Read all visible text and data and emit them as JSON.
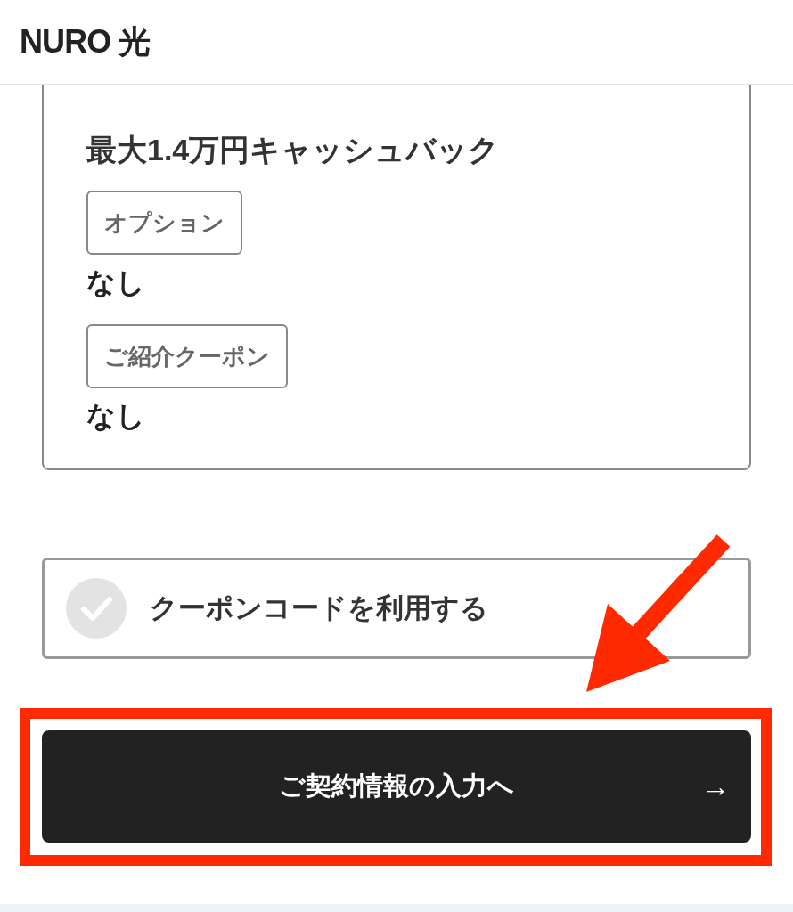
{
  "header": {
    "logo": "NURO 光"
  },
  "plan_card": {
    "title": "最大1.4万円キャッシュバック",
    "fields": [
      {
        "label": "オプション",
        "value": "なし"
      },
      {
        "label": "ご紹介クーポン",
        "value": "なし"
      }
    ]
  },
  "coupon_option": {
    "label": "クーポンコードを利用する",
    "checked": false
  },
  "next_button": {
    "label": "ご契約情報の入力へ",
    "icon": "→"
  }
}
